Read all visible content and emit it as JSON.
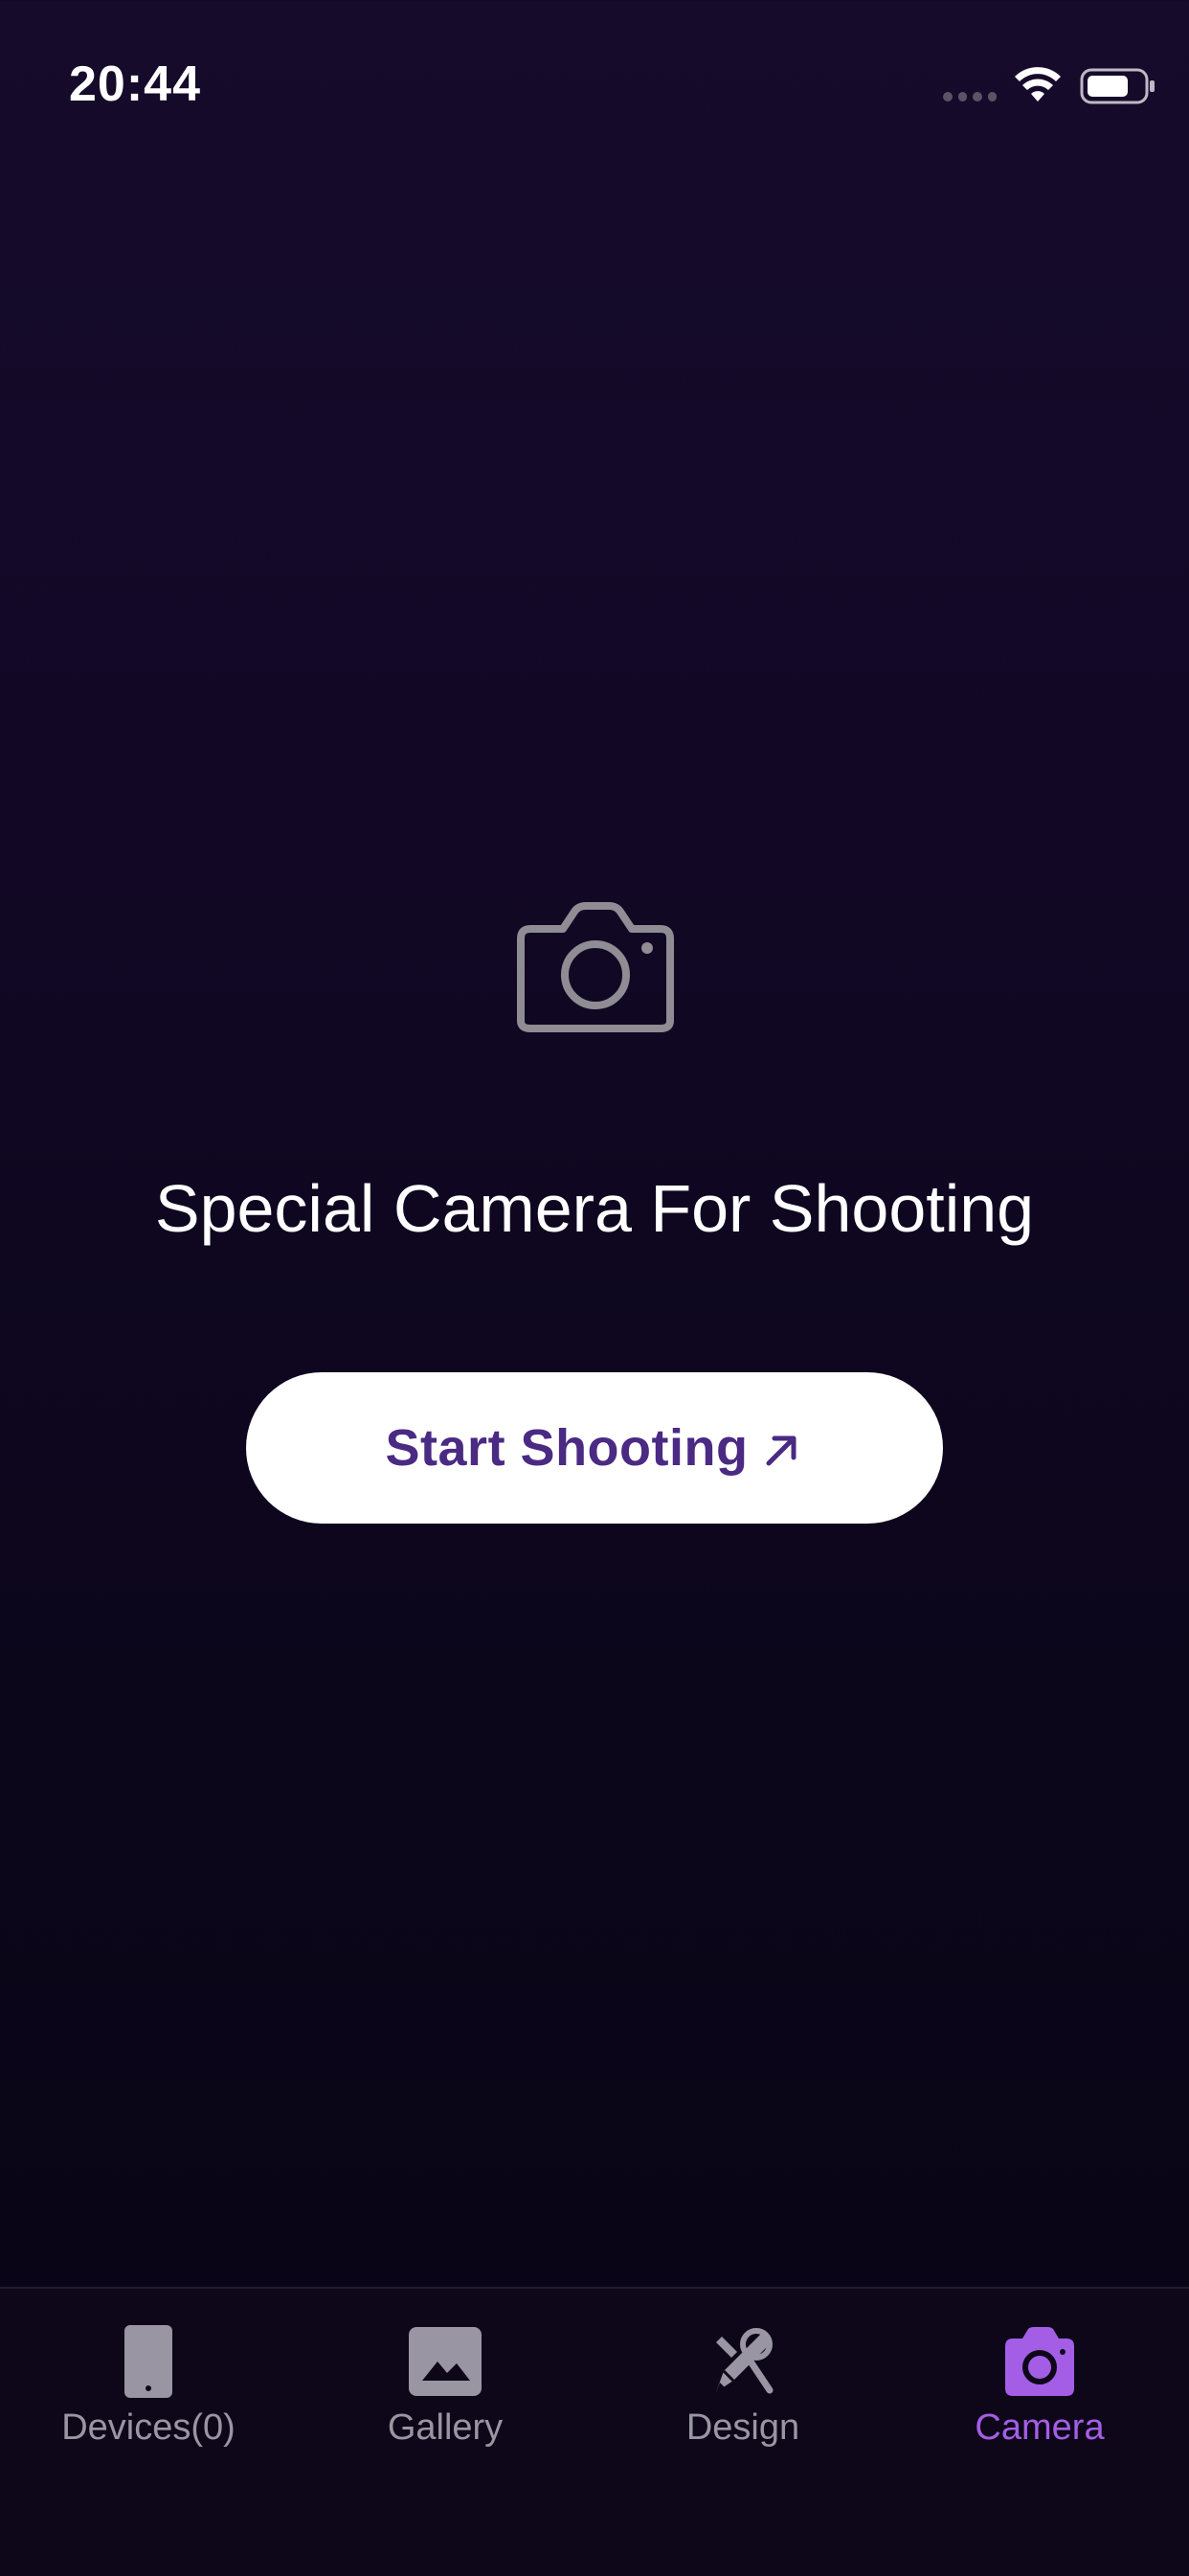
{
  "status_bar": {
    "time": "20:44",
    "icons": [
      "signal-dots-icon",
      "wifi-icon",
      "battery-icon"
    ]
  },
  "main": {
    "hero_icon": "camera-icon",
    "title": "Special Camera For Shooting",
    "start_button_label": "Start Shooting",
    "start_button_icon": "arrow-up-right-icon"
  },
  "tabs": [
    {
      "label": "Devices(0)",
      "icon": "device-icon",
      "active": false
    },
    {
      "label": "Gallery",
      "icon": "image-icon",
      "active": false
    },
    {
      "label": "Design",
      "icon": "design-tools-icon",
      "active": false
    },
    {
      "label": "Camera",
      "icon": "camera-icon",
      "active": true
    }
  ],
  "colors": {
    "background_top": "#160b2b",
    "background_bottom": "#080413",
    "accent": "#a45ee6",
    "button_text": "#4a2a82",
    "inactive_tab": "#9a95a2"
  }
}
